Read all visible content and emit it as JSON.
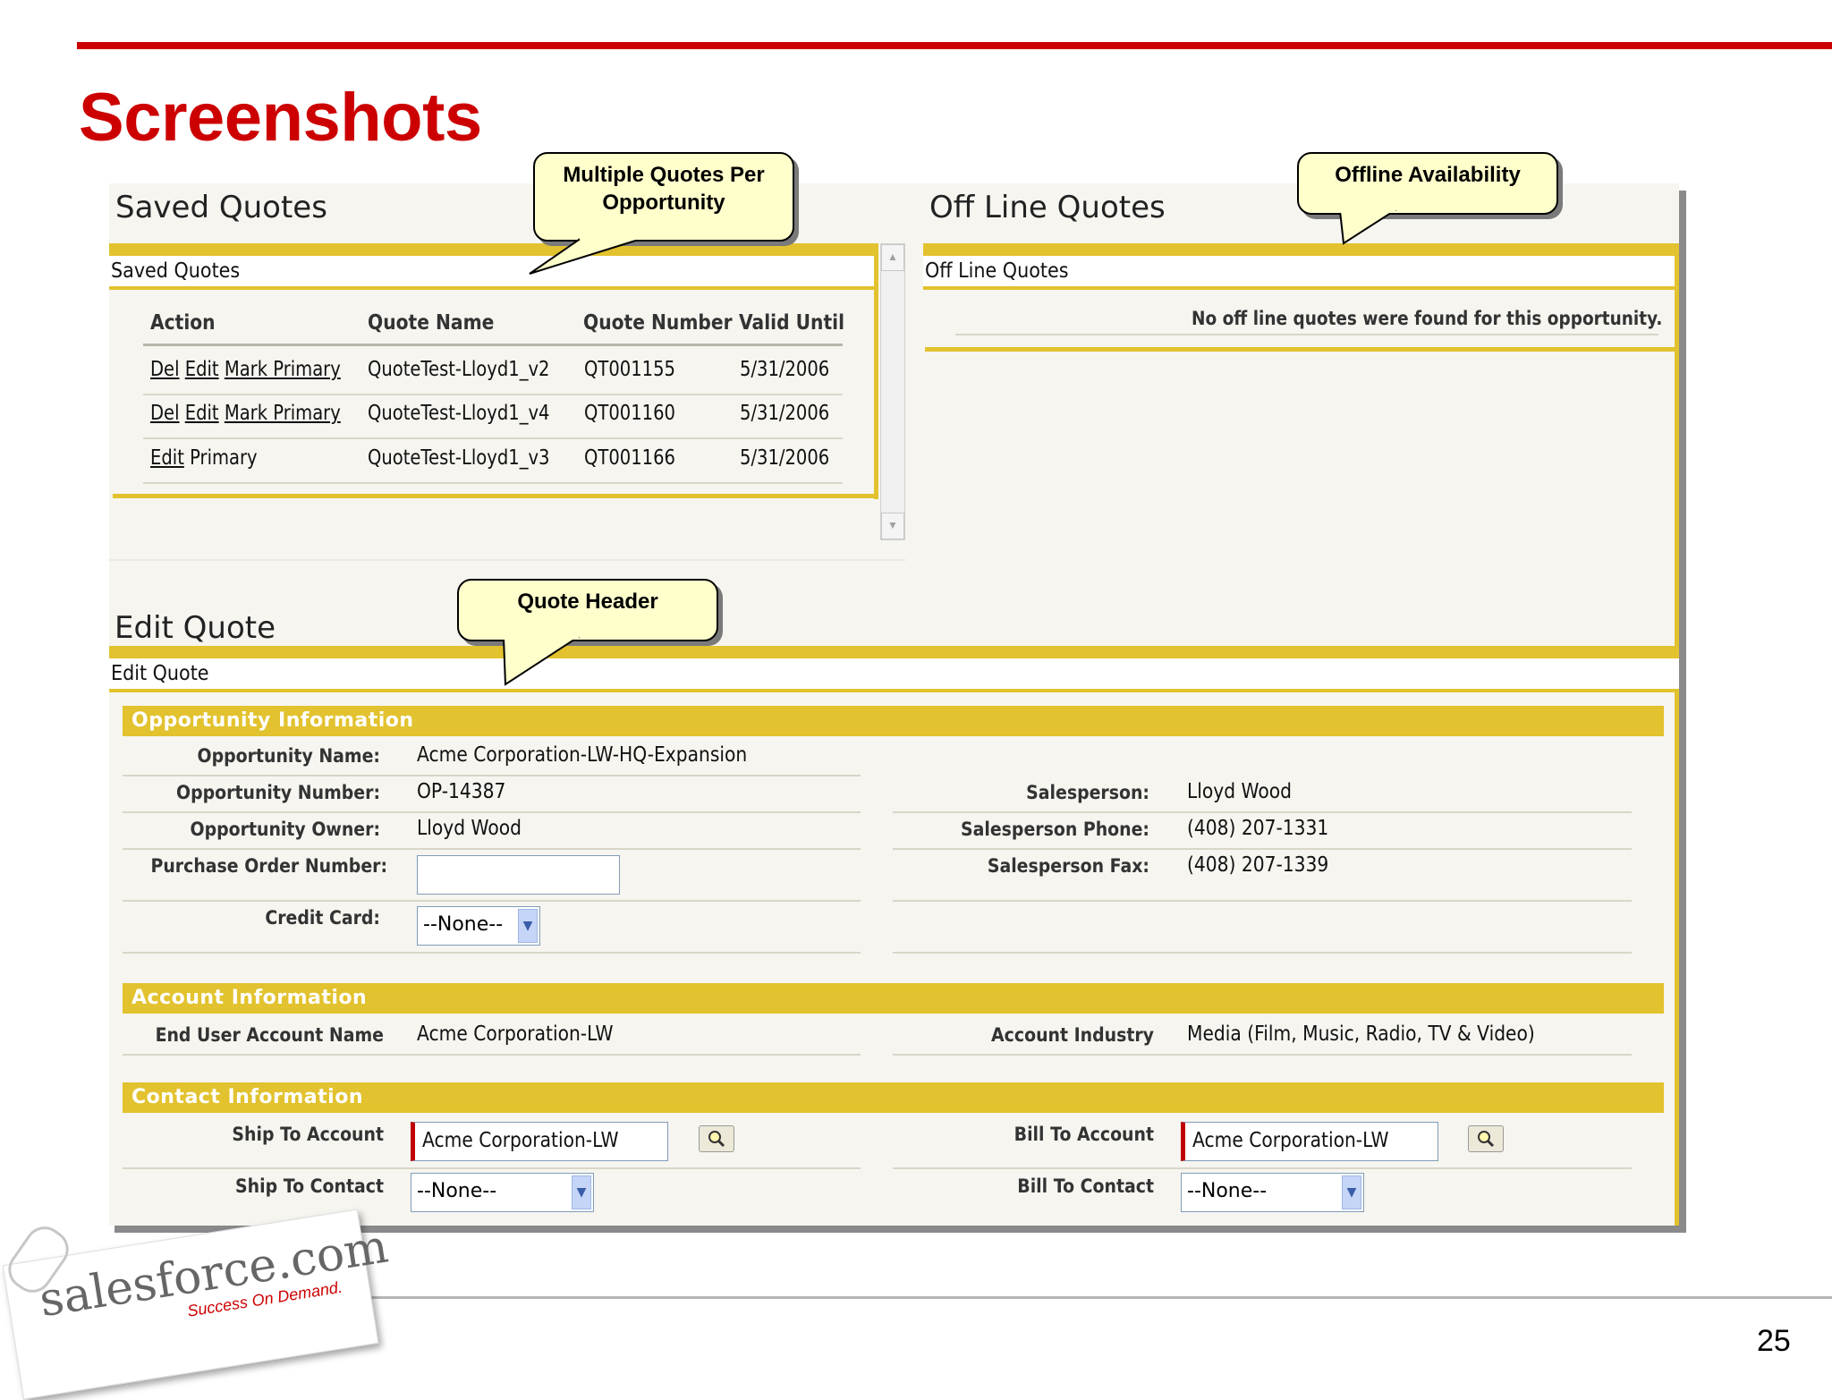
{
  "slide": {
    "title": "Screenshots",
    "page_number": "25",
    "brand": {
      "accent_color": "#cc0000",
      "highlight_color": "#e2c22e"
    }
  },
  "logo": {
    "wordmark": "salesforce.com",
    "tagline": "Success On Demand."
  },
  "callouts": {
    "multiple_quotes": "Multiple Quotes Per Opportunity",
    "offline": "Offline Availability",
    "quote_header": "Quote Header"
  },
  "saved_quotes": {
    "heading": "Saved Quotes",
    "strip_label": "Saved Quotes",
    "columns": [
      "Action",
      "Quote Name",
      "Quote Number",
      "Valid Until"
    ],
    "rows": [
      {
        "actions": [
          "Del",
          "Edit",
          "Mark Primary"
        ],
        "name": "QuoteTest-Lloyd1_v2",
        "number": "QT001155",
        "valid_until": "5/31/2006"
      },
      {
        "actions": [
          "Del",
          "Edit",
          "Mark Primary"
        ],
        "name": "QuoteTest-Lloyd1_v4",
        "number": "QT001160",
        "valid_until": "5/31/2006"
      },
      {
        "actions": [
          "Edit"
        ],
        "primary_label": "Primary",
        "name": "QuoteTest-Lloyd1_v3",
        "number": "QT001166",
        "valid_until": "5/31/2006"
      }
    ]
  },
  "offline_quotes": {
    "heading": "Off Line Quotes",
    "strip_label": "Off Line Quotes",
    "empty_message": "No off line quotes were found for this opportunity."
  },
  "edit_quote": {
    "heading": "Edit Quote",
    "strip_label": "Edit Quote",
    "opportunity": {
      "band": "Opportunity Information",
      "name_label": "Opportunity Name:",
      "name": "Acme Corporation-LW-HQ-Expansion",
      "number_label": "Opportunity Number:",
      "number": "OP-14387",
      "owner_label": "Opportunity Owner:",
      "owner": "Lloyd Wood",
      "po_label": "Purchase Order Number:",
      "po_value": "",
      "credit_card_label": "Credit Card:",
      "credit_card": "--None--",
      "salesperson_label": "Salesperson:",
      "salesperson": "Lloyd Wood",
      "phone_label": "Salesperson Phone:",
      "phone": "(408) 207-1331",
      "fax_label": "Salesperson Fax:",
      "fax": "(408) 207-1339"
    },
    "account": {
      "band": "Account Information",
      "end_user_label": "End User Account Name",
      "end_user": "Acme Corporation-LW",
      "industry_label": "Account Industry",
      "industry": "Media (Film, Music, Radio, TV & Video)"
    },
    "contact": {
      "band": "Contact Information",
      "ship_account_label": "Ship To Account",
      "ship_account": "Acme Corporation-LW",
      "ship_contact_label": "Ship To Contact",
      "ship_contact": "--None--",
      "bill_account_label": "Bill To Account",
      "bill_account": "Acme Corporation-LW",
      "bill_contact_label": "Bill To Contact",
      "bill_contact": "--None--"
    }
  }
}
